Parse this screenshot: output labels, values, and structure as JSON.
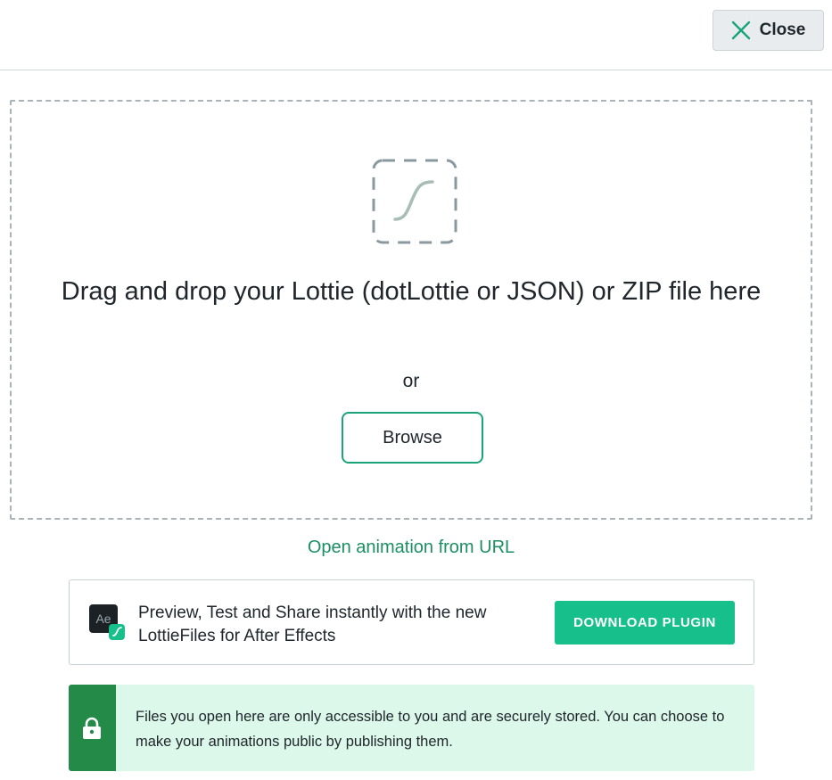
{
  "header": {
    "close_label": "Close"
  },
  "dropzone": {
    "prompt": "Drag and drop your Lottie (dotLottie or JSON) or ZIP file here",
    "or_label": "or",
    "browse_label": "Browse"
  },
  "url_link_label": "Open animation from URL",
  "plugin": {
    "icon_text": "Ae",
    "description": "Preview, Test and Share instantly with the new LottieFiles for After Effects",
    "download_label": "DOWNLOAD PLUGIN"
  },
  "notice": {
    "text": "Files you open here are only accessible to you and are securely stored. You can choose to make your animations public by publishing them."
  },
  "colors": {
    "accent": "#17bf8a",
    "link": "#1b8f63",
    "notice_bg": "#dcf8ea",
    "notice_side": "#238a48"
  }
}
